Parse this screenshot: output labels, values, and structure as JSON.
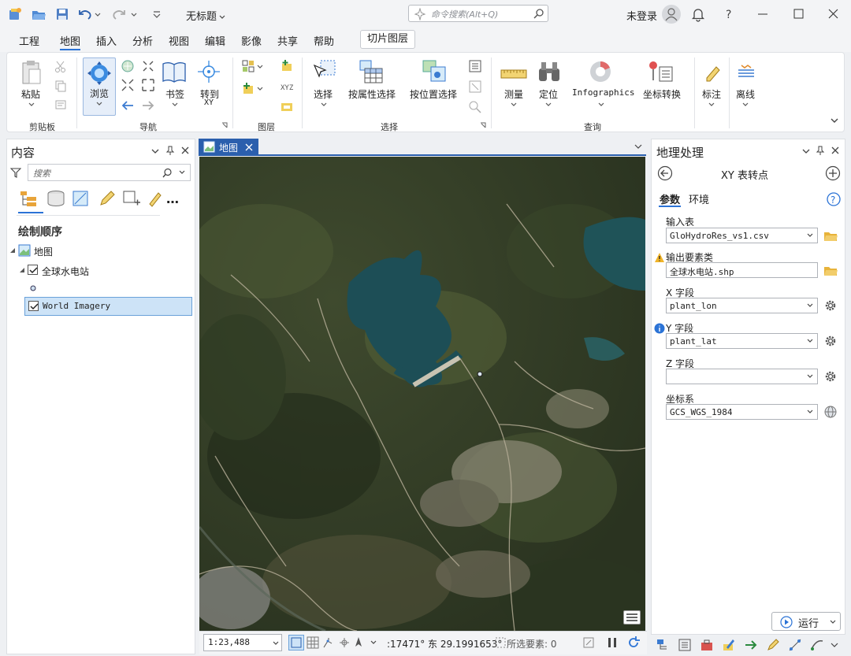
{
  "window": {
    "title": "无标题",
    "command_search_placeholder": "命令搜索(Alt+Q)",
    "login": "未登录"
  },
  "menu": {
    "tabs": [
      "工程",
      "地图",
      "插入",
      "分析",
      "视图",
      "编辑",
      "影像",
      "共享",
      "帮助"
    ],
    "active": "地图",
    "contextual_tab": "切片图层"
  },
  "ribbon": {
    "buttons": {
      "paste": "粘贴",
      "explore": "浏览",
      "bookmarks": "书签",
      "goto_xy_line1": "转到",
      "goto_xy_line2": "XY",
      "select": "选择",
      "select_by_attr": "按属性选择",
      "select_by_loc": "按位置选择",
      "measure": "测量",
      "locate": "定位",
      "infographics": "Infographics",
      "coord_convert": "坐标转换",
      "label": "标注",
      "offline": "离线"
    },
    "groups": {
      "clipboard": "剪贴板",
      "navigate": "导航",
      "layer": "图层",
      "selection": "选择",
      "inquiry": "查询"
    }
  },
  "contents": {
    "title": "内容",
    "search_placeholder": "搜索",
    "draw_order": "绘制顺序",
    "tree": {
      "map": "地图",
      "layer1": "全球水电站",
      "layer2": "World Imagery"
    }
  },
  "map": {
    "tab": "地图",
    "scale": "1:23,488",
    "coords": ":17471° 东 29.1991653°",
    "selected_features": "所选要素: 0"
  },
  "geoprocessing": {
    "title": "地理处理",
    "tool_title": "XY 表转点",
    "tabs": [
      "参数",
      "环境"
    ],
    "fields": {
      "input_table_label": "输入表",
      "input_table": "GloHydroRes_vs1.csv",
      "output_label": "输出要素类",
      "output": "全球水电站.shp",
      "x_label": "X 字段",
      "x_value": "plant_lon",
      "y_label": "Y 字段",
      "y_value": "plant_lat",
      "z_label": "Z 字段",
      "z_value": "",
      "crs_label": "坐标系",
      "crs_value": "GCS_WGS_1984"
    },
    "run": "运行"
  }
}
